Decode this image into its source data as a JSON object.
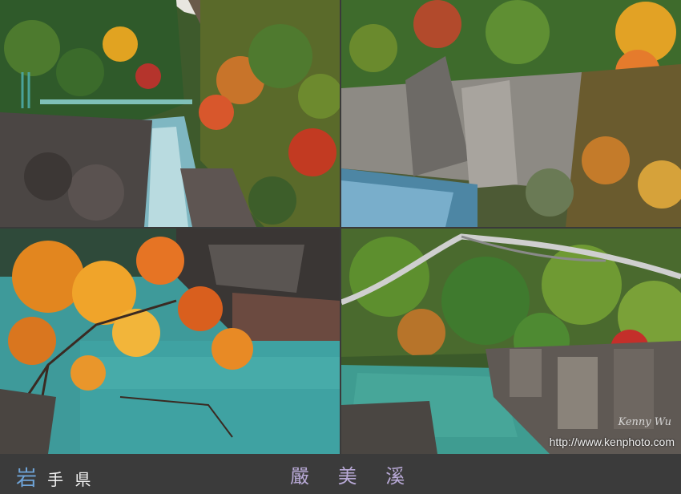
{
  "caption": {
    "prefecture_first": "岩",
    "prefecture_rest": "手 県",
    "place": "嚴 美 溪"
  },
  "photos": [
    {
      "subject": "river gorge with footbridge and autumn forest"
    },
    {
      "subject": "rocky cliff with autumn foliage above rapids"
    },
    {
      "subject": "orange maple leaves over turquoise river"
    },
    {
      "subject": "birch branch over turquoise pool and rock cliffs"
    }
  ],
  "watermark": {
    "url": "http://www.kenphoto.com",
    "signature": "Kenny Wu"
  }
}
